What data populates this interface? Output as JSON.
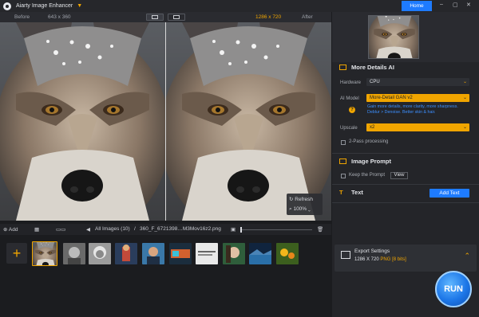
{
  "app": {
    "title": "Aiarty Image Enhancer",
    "home_label": "Home",
    "window_controls": {
      "minimize": "–",
      "maximize": "▢",
      "close": "✕"
    }
  },
  "compare": {
    "before_label": "Before",
    "before_res": "643 x 360",
    "after_res": "1286 x 720",
    "after_label": "After",
    "refresh_label": "Refresh",
    "zoom_label": "100%"
  },
  "toolbar": {
    "add_label": "Add",
    "all_images": "All Images (10)",
    "separator": "/",
    "file_name": "360_F_6721398…M3Mov16z2.png"
  },
  "panel": {
    "more_details": {
      "title": "More Details AI",
      "hardware_label": "Hardware",
      "hardware_value": "CPU",
      "model_label": "AI Model",
      "model_value": "More-Detail GAN v2",
      "model_desc_1": "Gain more details, more clarity, more sharpness.",
      "model_desc_2": "Deblur > Denoise. Better skin & hair.",
      "upscale_label": "Upscale",
      "upscale_value": "x2",
      "two_pass_label": "2-Pass processing"
    },
    "image_prompt": {
      "title": "Image Prompt",
      "keep_label": "Keep the Prompt",
      "view_label": "View"
    },
    "text": {
      "title": "Text",
      "add_text_label": "Add Text"
    },
    "export": {
      "title": "Export Settings",
      "res": "1286 X 720",
      "format": "PNG",
      "bits": "[8 bits]"
    },
    "run_label": "RUN"
  },
  "colors": {
    "accent": "#f0a500",
    "primary": "#1e7bff",
    "panel": "#242529"
  },
  "icons": [
    "app-logo-icon",
    "chevron-down-icon",
    "compare-split-icon",
    "compare-side-icon",
    "refresh-icon",
    "zoom-icon",
    "plus-icon",
    "grid-view-icon",
    "film-view-icon",
    "back-arrow-icon",
    "image-icon",
    "trash-icon",
    "chip-icon",
    "prompt-icon",
    "text-icon",
    "export-icon",
    "check-icon"
  ]
}
